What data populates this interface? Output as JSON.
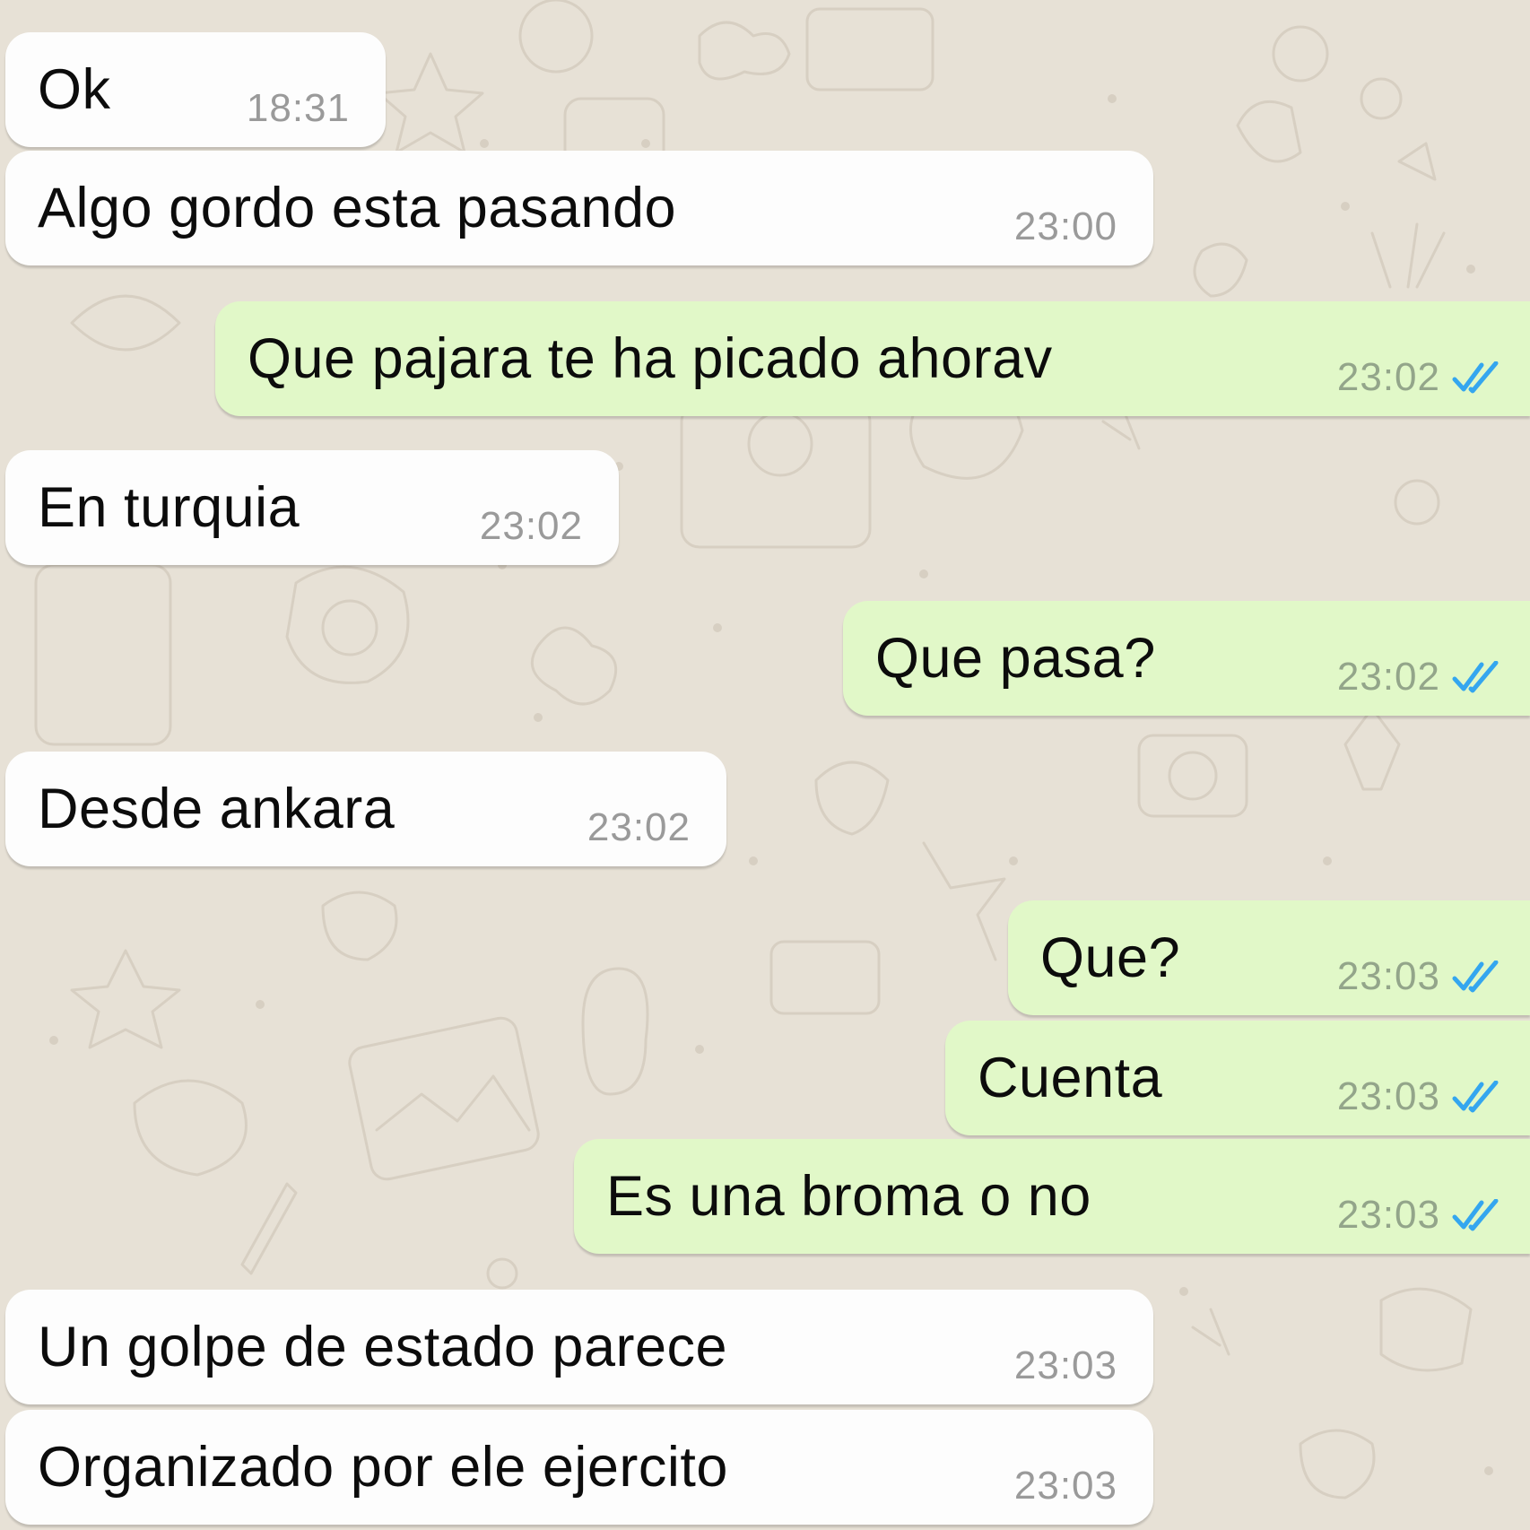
{
  "colors": {
    "wallpaper": "#e7e1d6",
    "incoming_bubble": "#fdfdfd",
    "outgoing_bubble": "#e1f8c8",
    "read_ticks": "#34a6ef",
    "timestamp_incoming": "#9a9a9a",
    "timestamp_outgoing": "#93a58a"
  },
  "icons": {
    "read_status": "double-check-icon"
  },
  "messages": [
    {
      "direction": "incoming",
      "text": "Ok",
      "time": "18:31"
    },
    {
      "direction": "incoming",
      "text": "Algo gordo esta pasando",
      "time": "23:00"
    },
    {
      "direction": "outgoing",
      "text": "Que pajara te ha picado ahorav",
      "time": "23:02",
      "status": "read"
    },
    {
      "direction": "incoming",
      "text": "En turquia",
      "time": "23:02"
    },
    {
      "direction": "outgoing",
      "text": "Que pasa?",
      "time": "23:02",
      "status": "read"
    },
    {
      "direction": "incoming",
      "text": "Desde ankara",
      "time": "23:02"
    },
    {
      "direction": "outgoing",
      "text": "Que?",
      "time": "23:03",
      "status": "read"
    },
    {
      "direction": "outgoing",
      "text": "Cuenta",
      "time": "23:03",
      "status": "read"
    },
    {
      "direction": "outgoing",
      "text": "Es una broma o no",
      "time": "23:03",
      "status": "read"
    },
    {
      "direction": "incoming",
      "text": "Un golpe de estado parece",
      "time": "23:03"
    },
    {
      "direction": "incoming",
      "text": "Organizado por ele ejercito",
      "time": "23:03"
    }
  ]
}
